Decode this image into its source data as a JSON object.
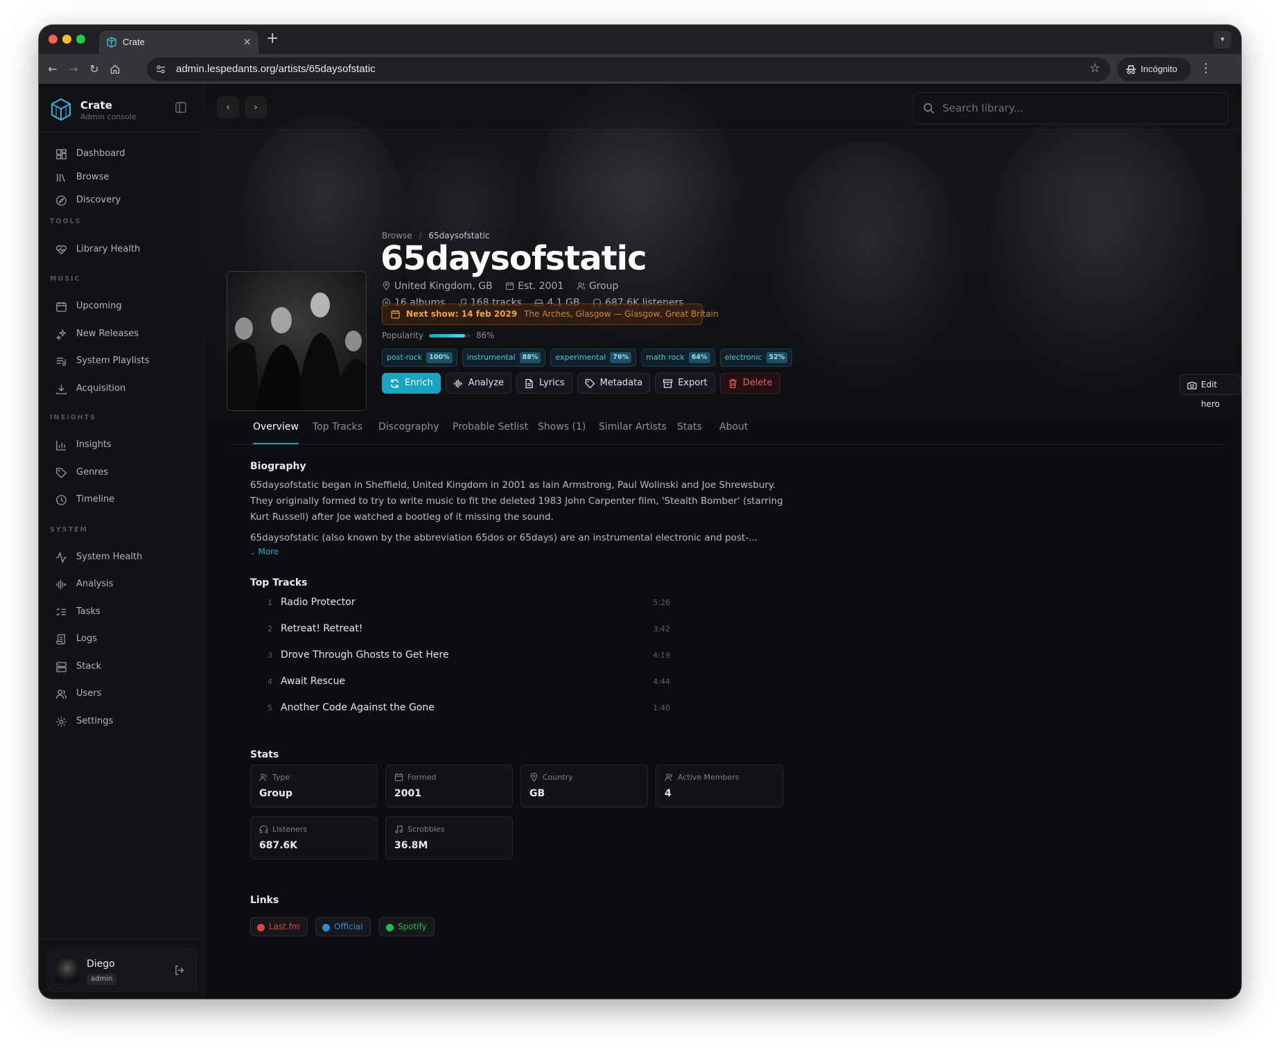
{
  "browser": {
    "tab_title": "Crate",
    "url": "admin.lespedants.org/artists/65daysofstatic",
    "incognito_label": "Incógnito"
  },
  "sidebar": {
    "brand_name": "Crate",
    "brand_subtitle": "Admin console",
    "top_items": [
      {
        "label": "Dashboard",
        "icon": "dashboard-icon"
      },
      {
        "label": "Browse",
        "icon": "library-icon"
      },
      {
        "label": "Discovery",
        "icon": "compass-icon"
      }
    ],
    "sections": [
      {
        "label": "TOOLS",
        "items": [
          {
            "label": "Library Health",
            "icon": "heart-pulse-icon"
          }
        ]
      },
      {
        "label": "MUSIC",
        "items": [
          {
            "label": "Upcoming",
            "icon": "calendar-icon"
          },
          {
            "label": "New Releases",
            "icon": "sparkles-icon"
          },
          {
            "label": "System Playlists",
            "icon": "playlist-icon"
          },
          {
            "label": "Acquisition",
            "icon": "download-icon"
          }
        ]
      },
      {
        "label": "INSIGHTS",
        "items": [
          {
            "label": "Insights",
            "icon": "bar-chart-icon"
          },
          {
            "label": "Genres",
            "icon": "tag-icon"
          },
          {
            "label": "Timeline",
            "icon": "clock-icon"
          }
        ]
      },
      {
        "label": "SYSTEM",
        "items": [
          {
            "label": "System Health",
            "icon": "activity-icon"
          },
          {
            "label": "Analysis",
            "icon": "waveform-icon"
          },
          {
            "label": "Tasks",
            "icon": "tasks-icon"
          },
          {
            "label": "Logs",
            "icon": "scroll-icon"
          },
          {
            "label": "Stack",
            "icon": "server-icon"
          },
          {
            "label": "Users",
            "icon": "users-icon"
          },
          {
            "label": "Settings",
            "icon": "gear-icon"
          }
        ]
      }
    ],
    "user": {
      "name": "Diego",
      "role": "admin"
    }
  },
  "search": {
    "placeholder": "Search library..."
  },
  "artist": {
    "breadcrumb_parent": "Browse",
    "breadcrumb_separator": "/",
    "breadcrumb_current": "65daysofstatic",
    "name": "65daysofstatic",
    "location": "United Kingdom, GB",
    "established": "Est. 2001",
    "type": "Group",
    "albums": "16 albums",
    "tracks": "168 tracks",
    "size": "4.1 GB",
    "listeners": "687.6K listeners",
    "next_show_label": "Next show: 14 feb 2029",
    "next_show_location": "The Arches, Glasgow — Glasgow, Great Britain",
    "popularity_label": "Popularity",
    "popularity_value": 86,
    "popularity_text": "86%",
    "tags": [
      {
        "name": "post-rock",
        "pct": "100%"
      },
      {
        "name": "instrumental",
        "pct": "88%"
      },
      {
        "name": "experimental",
        "pct": "76%"
      },
      {
        "name": "math rock",
        "pct": "64%"
      },
      {
        "name": "electronic",
        "pct": "52%"
      }
    ],
    "actions": [
      "Enrich",
      "Analyze",
      "Lyrics",
      "Metadata",
      "Export",
      "Delete"
    ],
    "edit_hero_label": "Edit hero"
  },
  "tabs": [
    "Overview",
    "Top Tracks",
    "Discography",
    "Probable Setlist",
    "Shows (1)",
    "Similar Artists",
    "Stats",
    "About"
  ],
  "overview": {
    "biography_title": "Biography",
    "bio_paragraph_1": "65daysofstatic began in Sheffield, United Kingdom in 2001 as Iain Armstrong, Paul Wolinski and Joe Shrewsbury. They originally formed to try to write music to fit the deleted 1983 John Carpenter film, 'Stealth Bomber' (starring Kurt Russell) after Joe watched a bootleg of it missing the sound.",
    "bio_paragraph_2": "65daysofstatic (also known by the abbreviation 65dos or 65days) are an instrumental electronic and post-...",
    "more_label": "More",
    "top_tracks_title": "Top Tracks",
    "top_tracks": [
      {
        "num": "1",
        "name": "Radio Protector",
        "duration": "5:26"
      },
      {
        "num": "2",
        "name": "Retreat! Retreat!",
        "duration": "3:42"
      },
      {
        "num": "3",
        "name": "Drove Through Ghosts to Get Here",
        "duration": "4:19"
      },
      {
        "num": "4",
        "name": "Await Rescue",
        "duration": "4:44"
      },
      {
        "num": "5",
        "name": "Another Code Against the Gone",
        "duration": "1:40"
      }
    ],
    "stats_title": "Stats",
    "stats": [
      {
        "label": "Type",
        "value": "Group"
      },
      {
        "label": "Formed",
        "value": "2001"
      },
      {
        "label": "Country",
        "value": "GB"
      },
      {
        "label": "Active Members",
        "value": "4"
      },
      {
        "label": "Listeners",
        "value": "687.6K"
      },
      {
        "label": "Scrobbles",
        "value": "36.8M"
      }
    ],
    "links_title": "Links",
    "links": [
      {
        "label": "Last.fm",
        "color": "#e0463e"
      },
      {
        "label": "Official",
        "color": "#2a8fd6"
      },
      {
        "label": "Spotify",
        "color": "#1db954"
      }
    ]
  },
  "colors": {
    "accent": "#1aa3c0",
    "danger": "#ee5a5a",
    "warning": "#f0a23d"
  }
}
